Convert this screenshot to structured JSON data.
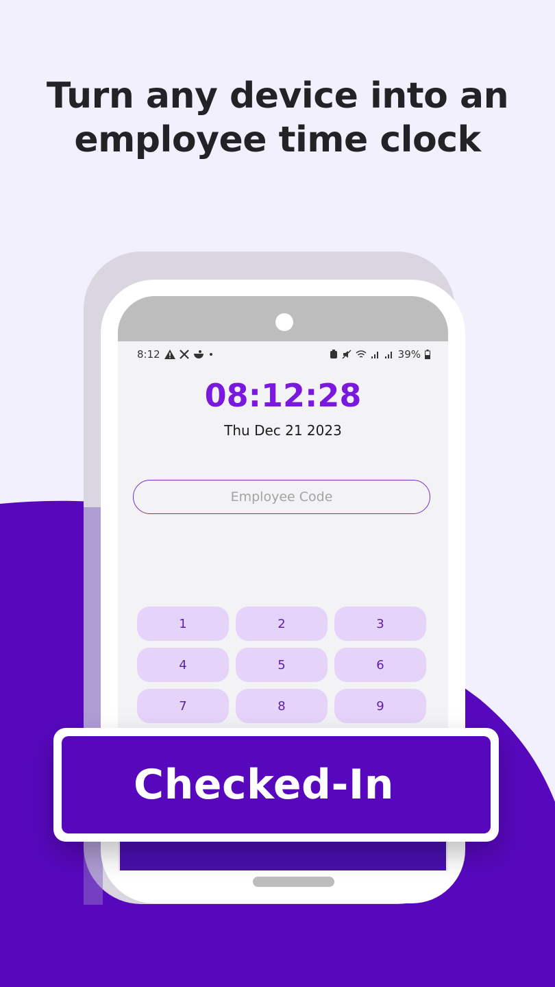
{
  "headline": {
    "line1": "Turn any device into an",
    "line2": "employee time clock"
  },
  "status_bar": {
    "time": "8:12",
    "battery": "39%",
    "left_icons": [
      "alert-icon",
      "x-icon",
      "bowl-icon",
      "dot-icon"
    ],
    "right_icons": [
      "shield-icon",
      "mute-icon",
      "wifi-icon",
      "signal-icon",
      "signal-icon",
      "battery-icon"
    ]
  },
  "time_clock": {
    "time": "08:12:28",
    "date": "Thu Dec 21 2023",
    "employee_code_placeholder": "Employee Code"
  },
  "keypad": {
    "keys": [
      "1",
      "2",
      "3",
      "4",
      "5",
      "6",
      "7",
      "8",
      "9"
    ]
  },
  "banner": {
    "label": "Checked-In"
  },
  "colors": {
    "background": "#f3f0fd",
    "brand_purple": "#5708bd",
    "clock_purple": "#7b18dd",
    "key_fill": "#e6d3fa"
  }
}
